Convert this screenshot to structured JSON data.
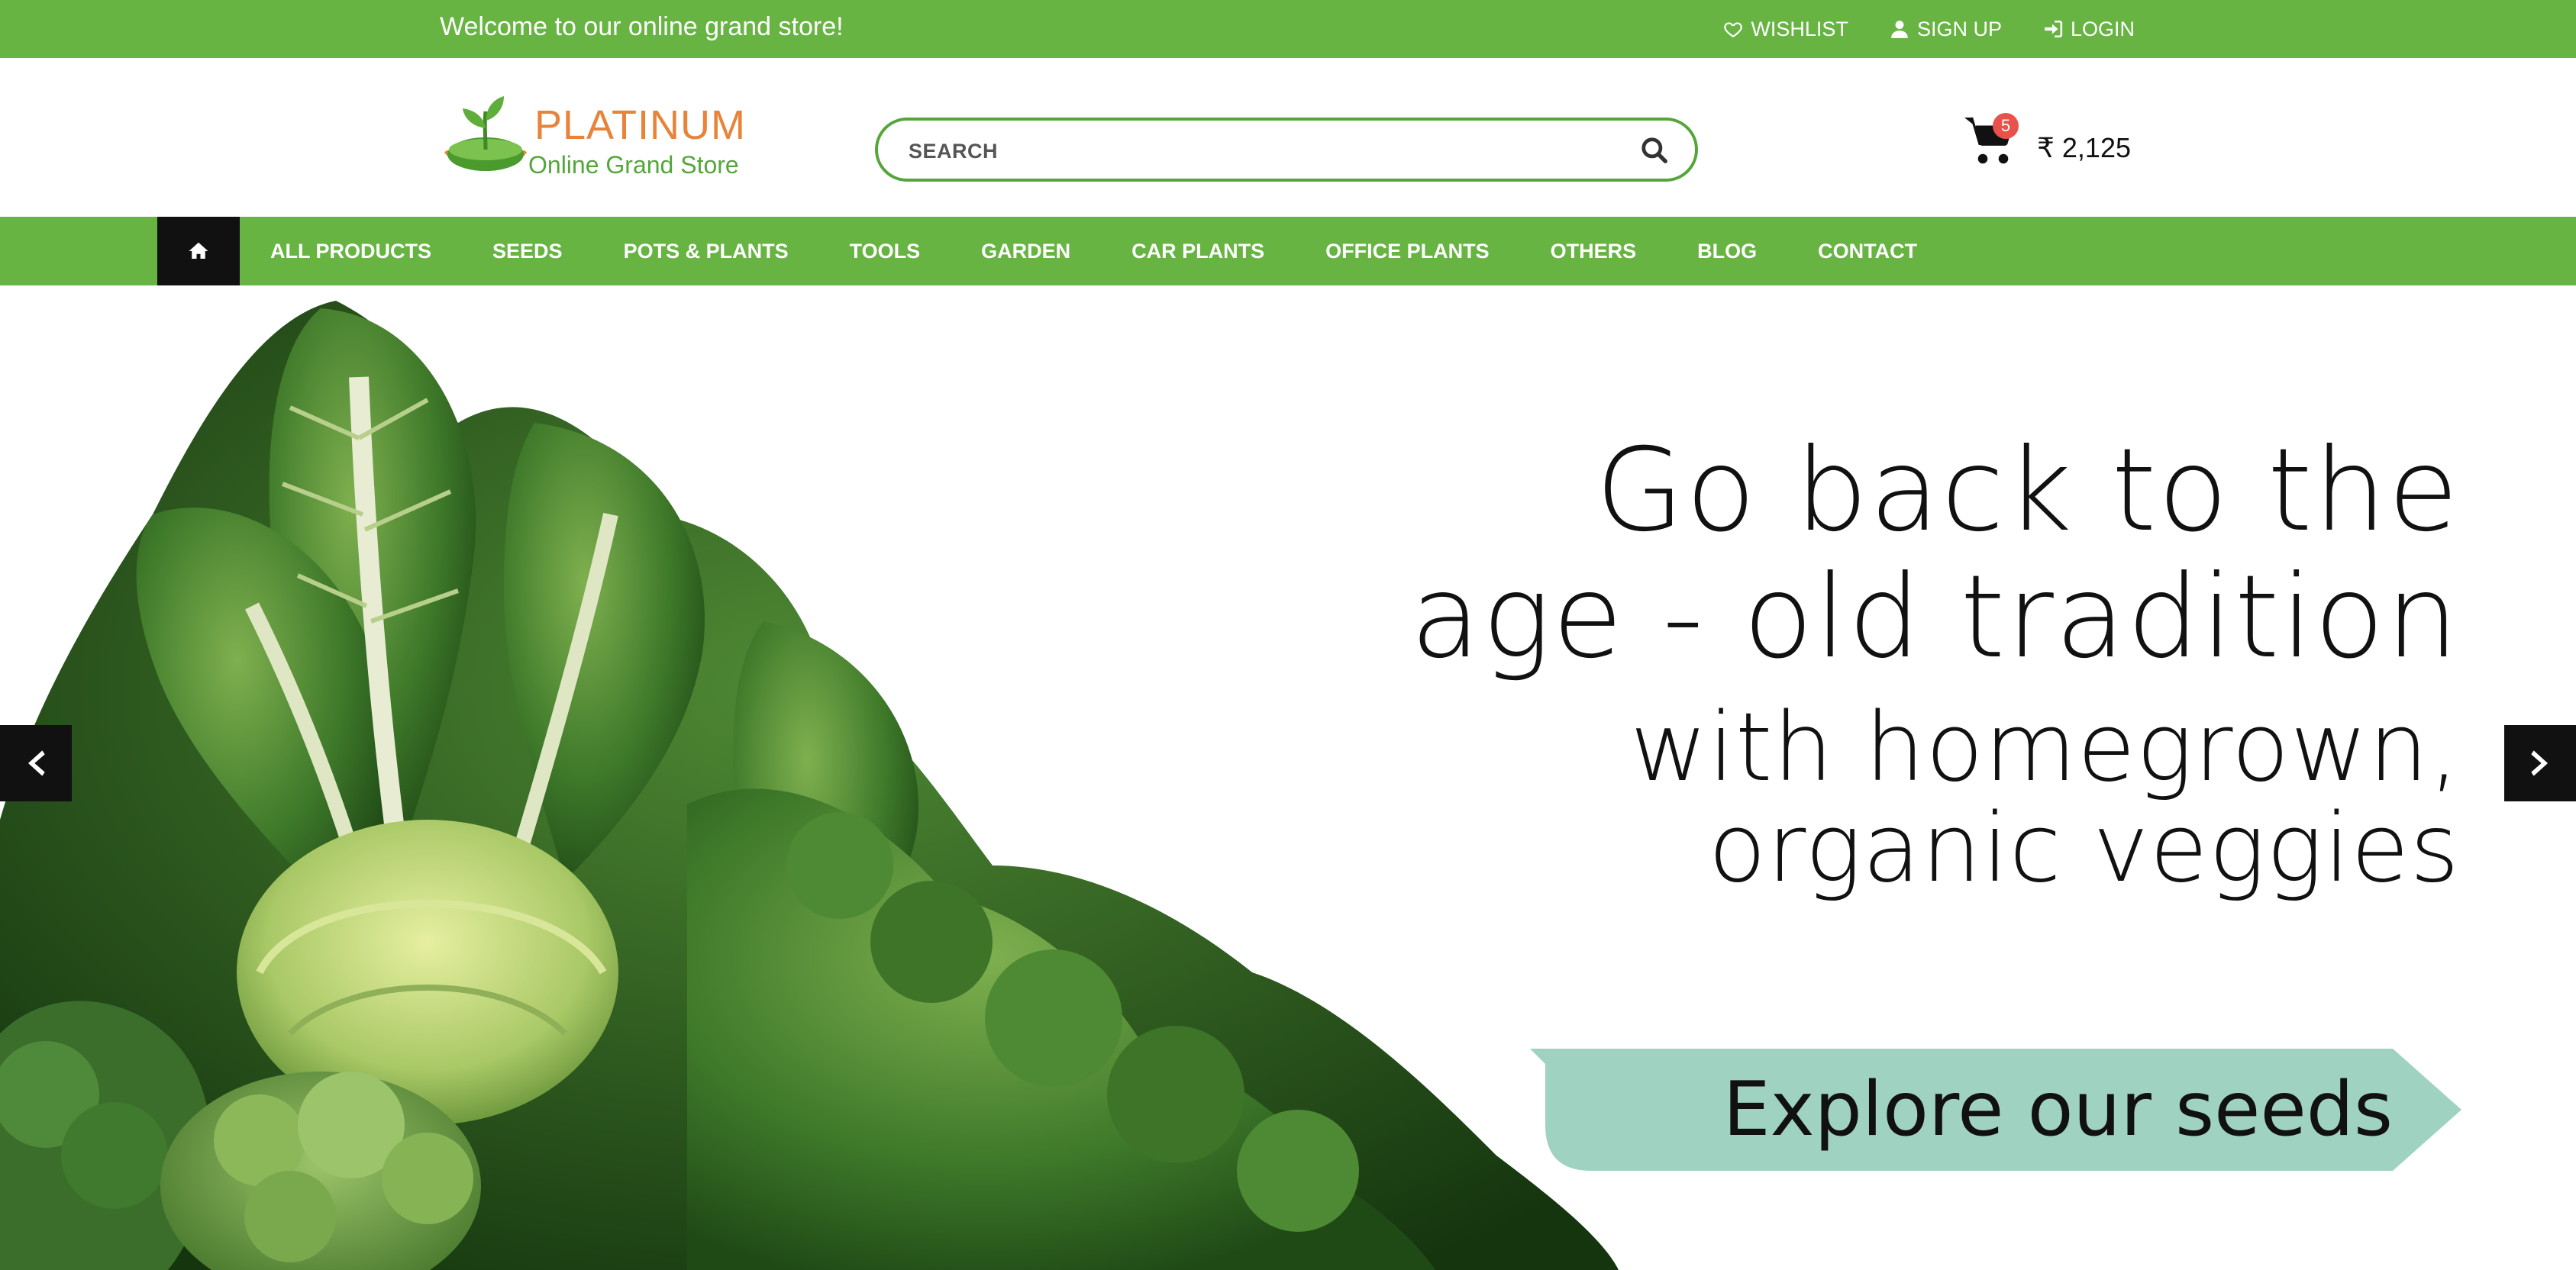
{
  "topbar": {
    "welcome": "Welcome to our online grand store!",
    "links": [
      {
        "label": "WISHLIST",
        "icon": "heart-icon"
      },
      {
        "label": "SIGN UP",
        "icon": "user-icon"
      },
      {
        "label": "LOGIN",
        "icon": "sign-in-icon"
      }
    ]
  },
  "header": {
    "brand": "PLATINUM",
    "tagline": "Online Grand Store",
    "search_placeholder": "SEARCH",
    "cart_count": "5",
    "cart_total": "₹ 2,125"
  },
  "nav": {
    "home_icon": "home-icon",
    "items": [
      "ALL PRODUCTS",
      "SEEDS",
      "POTS & PLANTS",
      "TOOLS",
      "GARDEN",
      "CAR PLANTS",
      "OFFICE PLANTS",
      "OTHERS",
      "BLOG",
      "CONTACT"
    ]
  },
  "hero": {
    "line1": "Go back to the",
    "line2": "age - old tradition",
    "line3": "with homegrown,",
    "line4": "organic veggies",
    "cta": "Explore our seeds",
    "prev_icon": "chevron-left-icon",
    "next_icon": "chevron-right-icon"
  },
  "colors": {
    "brand_green": "#67b443",
    "brand_orange": "#e8833a",
    "cta_bg": "#9fd2c0",
    "badge_red": "#e8524a"
  }
}
